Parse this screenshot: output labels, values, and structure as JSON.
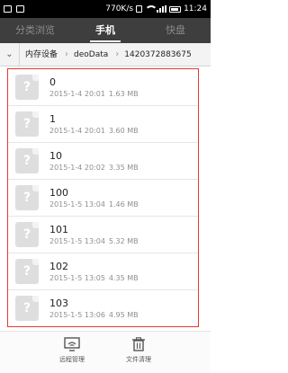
{
  "status_bar": {
    "network_speed": "770K/s",
    "time": "11:24"
  },
  "tabs": [
    {
      "label": "分类浏览",
      "active": false
    },
    {
      "label": "手机",
      "active": true
    },
    {
      "label": "快盘",
      "active": false
    }
  ],
  "breadcrumb": {
    "items": [
      "内存设备",
      "deoData",
      "1420372883675"
    ]
  },
  "files": [
    {
      "name": "0",
      "date": "2015-1-4 20:01",
      "size": "1.63 MB"
    },
    {
      "name": "1",
      "date": "2015-1-4 20:01",
      "size": "3.60 MB"
    },
    {
      "name": "10",
      "date": "2015-1-4 20:02",
      "size": "3.35 MB"
    },
    {
      "name": "100",
      "date": "2015-1-5 13:04",
      "size": "1.46 MB"
    },
    {
      "name": "101",
      "date": "2015-1-5 13:04",
      "size": "5.32 MB"
    },
    {
      "name": "102",
      "date": "2015-1-5 13:05",
      "size": "4.35 MB"
    },
    {
      "name": "103",
      "date": "2015-1-5 13:06",
      "size": "4.95 MB"
    }
  ],
  "bottom_actions": [
    {
      "label": "远程管理",
      "icon": "remote-manage-icon"
    },
    {
      "label": "文件清理",
      "icon": "trash-icon"
    }
  ],
  "colors": {
    "tab_bar_bg": "#3e3e3e",
    "highlight_border": "#e53935"
  }
}
